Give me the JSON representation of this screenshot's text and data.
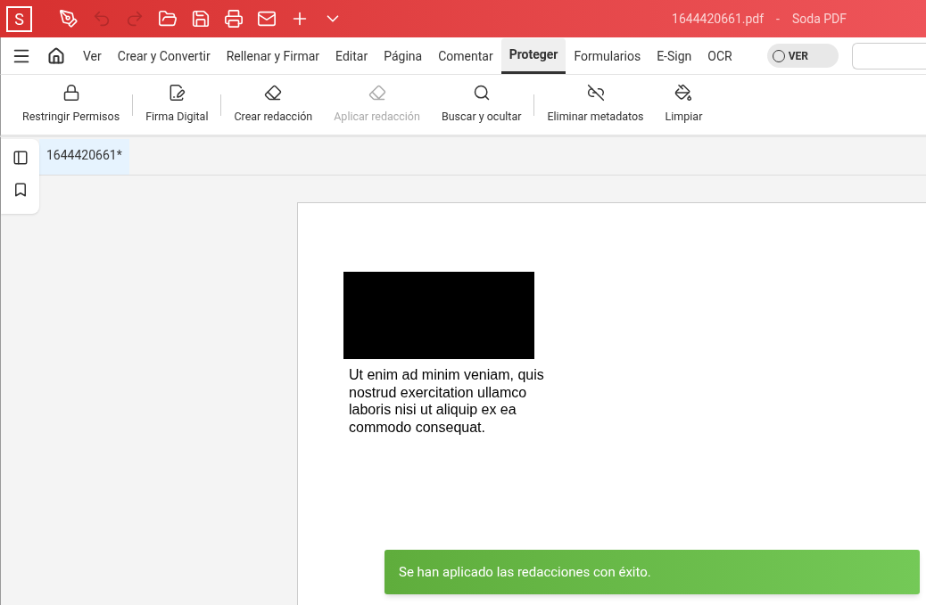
{
  "window": {
    "app_letter": "S",
    "title": "1644420661.pdf",
    "separator": "-",
    "app_name": "Soda PDF"
  },
  "quick_access": [
    {
      "kind": "pen",
      "disabled": false
    },
    {
      "kind": "undo",
      "disabled": true
    },
    {
      "kind": "redo",
      "disabled": true
    },
    {
      "kind": "open",
      "disabled": false
    },
    {
      "kind": "save",
      "disabled": false
    },
    {
      "kind": "print",
      "disabled": false
    },
    {
      "kind": "mail",
      "disabled": false
    },
    {
      "kind": "plus",
      "disabled": false
    },
    {
      "kind": "more",
      "disabled": false
    }
  ],
  "menu_tabs": [
    {
      "label": "Ver",
      "selected": false
    },
    {
      "label": "Crear y Convertir",
      "selected": false
    },
    {
      "label": "Rellenar y Firmar",
      "selected": false
    },
    {
      "label": "Editar",
      "selected": false
    },
    {
      "label": "Página",
      "selected": false
    },
    {
      "label": "Comentar",
      "selected": false
    },
    {
      "label": "Proteger",
      "selected": true
    },
    {
      "label": "Formularios",
      "selected": false
    },
    {
      "label": "E-Sign",
      "selected": false
    },
    {
      "label": "OCR",
      "selected": false
    }
  ],
  "view_toggle": {
    "label": "VER",
    "on": false
  },
  "toolbar_groups": [
    [
      {
        "kind": "lock",
        "label": "Restringir Permisos",
        "disabled": false
      }
    ],
    [
      {
        "kind": "signature",
        "label": "Firma Digital",
        "disabled": false
      }
    ],
    [
      {
        "kind": "redact-add",
        "label": "Crear redacción",
        "disabled": false
      },
      {
        "kind": "redact-apply",
        "label": "Aplicar redacción",
        "disabled": true
      },
      {
        "kind": "search",
        "label": "Buscar y ocultar",
        "disabled": false
      }
    ],
    [
      {
        "kind": "unlink",
        "label": "Eliminar metadatos",
        "disabled": false
      },
      {
        "kind": "clean",
        "label": "Limpiar",
        "disabled": false
      }
    ]
  ],
  "sidebar": [
    {
      "kind": "panel"
    },
    {
      "kind": "bookmark"
    }
  ],
  "document_tabs": [
    {
      "label": "1644420661*",
      "selected": true
    }
  ],
  "page": {
    "paragraph": "Ut enim ad minim veniam, quis nostrud exercitation ullamco laboris nisi ut aliquip ex ea commodo consequat."
  },
  "toast": {
    "message": "Se han aplicado las redacciones con éxito."
  }
}
